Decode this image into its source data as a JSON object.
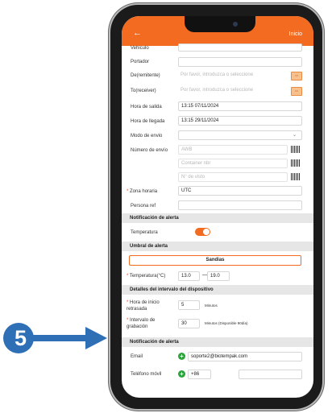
{
  "header": {
    "title": "",
    "inicio": "Inicio"
  },
  "fields": {
    "vehiculo": {
      "label": "Vehiculo"
    },
    "portador": {
      "label": "Portador"
    },
    "de": {
      "label": "De(remitente)",
      "placeholder": "Por favor, introduzca o seleccione"
    },
    "to": {
      "label": "To(receiver)",
      "placeholder": "Por favor, introduzca o seleccione"
    },
    "salida": {
      "label": "Hora de salida",
      "value": "13:15 07/11/2024"
    },
    "llegada": {
      "label": "Hora de llegada",
      "value": "13:15 29/11/2024"
    },
    "modo": {
      "label": "Modo de envio",
      "value": ""
    },
    "numero": {
      "label": "Número de envío",
      "awb": "AWB",
      "container": "Container nbr",
      "visto": "N° de visto"
    },
    "zona": {
      "label": "Zona horaria",
      "value": "UTC"
    },
    "persona": {
      "label": "Persona ref",
      "value": ""
    }
  },
  "sections": {
    "notif1": "Notificación de alerta",
    "umbral": "Umbral de alerta",
    "detalles": "Detalles del intervalo del dispositivo",
    "notif2": "Notificación de alerta"
  },
  "temperatura": {
    "label": "Temperatura",
    "enabled": true
  },
  "umbral": {
    "product": "Sandias",
    "label": "Temperatura(°C)",
    "min": "13.0",
    "max": "19.0",
    "dash": "—"
  },
  "intervalo": {
    "inicio_label": "Hora de inicio retrasada",
    "inicio_value": "5",
    "inicio_unit": "Minutos",
    "grab_label": "Intervalo de grabación",
    "grab_value": "30",
    "grab_unit": "Minutos (Disponible 90día)"
  },
  "contact": {
    "email_label": "Email",
    "email_value": "soporte2@biotempak.com",
    "phone_label": "Teléfono móvil",
    "phone_code": "+86",
    "phone_value": ""
  },
  "annotation": {
    "step": "5"
  },
  "colors": {
    "accent": "#f26b21",
    "annotation": "#2f6fb6",
    "add": "#29a33a"
  }
}
